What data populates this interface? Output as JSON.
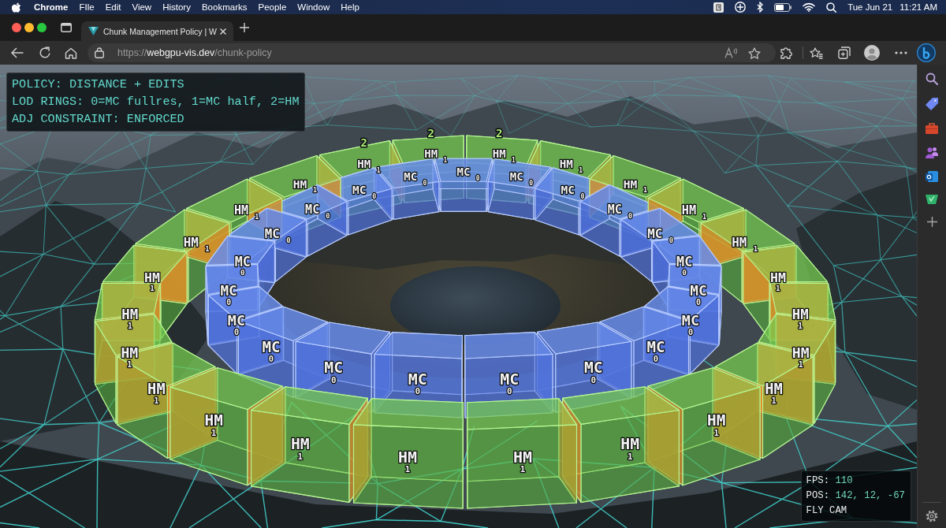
{
  "menu_bar": {
    "app": "Chrome",
    "menus": [
      "FIle",
      "Edit",
      "View",
      "History",
      "Bookmarks",
      "People",
      "Window",
      "Help"
    ],
    "date": "Tue Jun 21",
    "time": "11:21 AM"
  },
  "tabs": [
    {
      "title": "Chunk Management Policy | W",
      "selected": true
    }
  ],
  "address_bar": {
    "scheme": "https://",
    "host": "webgpu-vis.dev",
    "path": "/chunk-policy"
  },
  "scene": {
    "info_panel": [
      "POLICY: DISTANCE + EDITS",
      "LOD RINGS: 0=MC fullres, 1=MC half, 2=HM",
      "ADJ CONSTRAINT: ENFORCED"
    ],
    "rings": [
      {
        "kind": "heightmap",
        "chunks": [
          {
            "label": "HM",
            "lod": "1",
            "marker": "2"
          },
          {
            "label": "HM",
            "lod": "1",
            "marker": "2"
          },
          {
            "label": "HM",
            "lod": "1",
            "marker": "2"
          },
          {
            "label": "HM",
            "lod": "1"
          },
          {
            "label": "HM",
            "lod": "1"
          },
          {
            "label": "HM",
            "lod": "1"
          },
          {
            "label": "HM",
            "lod": "1"
          },
          {
            "label": "HM",
            "lod": "1"
          },
          {
            "label": "HM",
            "lod": "1"
          },
          {
            "label": "HM",
            "lod": "1"
          },
          {
            "label": "HM",
            "lod": "1"
          },
          {
            "label": "HM",
            "lod": "1"
          },
          {
            "label": "HM",
            "lod": "1"
          },
          {
            "label": "HM",
            "lod": "1"
          },
          {
            "label": "HM",
            "lod": "1"
          },
          {
            "label": "HM",
            "lod": "1"
          },
          {
            "label": "HM",
            "lod": "1"
          },
          {
            "label": "HM",
            "lod": "1"
          },
          {
            "label": "HM",
            "lod": "1"
          },
          {
            "label": "HM",
            "lod": "1"
          },
          {
            "label": "HM",
            "lod": "1"
          },
          {
            "label": "HM",
            "lod": "1"
          },
          {
            "label": "HM",
            "lod": "1"
          },
          {
            "label": "HM",
            "lod": "1"
          }
        ]
      },
      {
        "kind": "mesh",
        "chunks": [
          {
            "label": "MC",
            "lod": "0"
          },
          {
            "label": "MC",
            "lod": "0"
          },
          {
            "label": "MC",
            "lod": "0"
          },
          {
            "label": "MC",
            "lod": "0"
          },
          {
            "label": "MC",
            "lod": "0"
          },
          {
            "label": "MC",
            "lod": "0"
          },
          {
            "label": "MC",
            "lod": "0"
          },
          {
            "label": "MC",
            "lod": "0"
          },
          {
            "label": "MC",
            "lod": "0"
          },
          {
            "label": "MC",
            "lod": "0"
          },
          {
            "label": "MC",
            "lod": "0"
          },
          {
            "label": "MC",
            "lod": "0"
          },
          {
            "label": "MC",
            "lod": "0"
          },
          {
            "label": "MC",
            "lod": "0"
          },
          {
            "label": "MC",
            "lod": "0"
          },
          {
            "label": "MC",
            "lod": "0"
          },
          {
            "label": "MC",
            "lod": "0"
          },
          {
            "label": "MC",
            "lod": "0"
          },
          {
            "label": "MC",
            "lod": "0"
          },
          {
            "label": "MC",
            "lod": "0"
          },
          {
            "label": "MC",
            "lod": "0"
          }
        ]
      }
    ],
    "hud": [
      {
        "label": "FPS:",
        "value": "110"
      },
      {
        "label": "POS:",
        "value": "142, 12, -67"
      },
      {
        "label": "FLY CAM"
      }
    ]
  }
}
